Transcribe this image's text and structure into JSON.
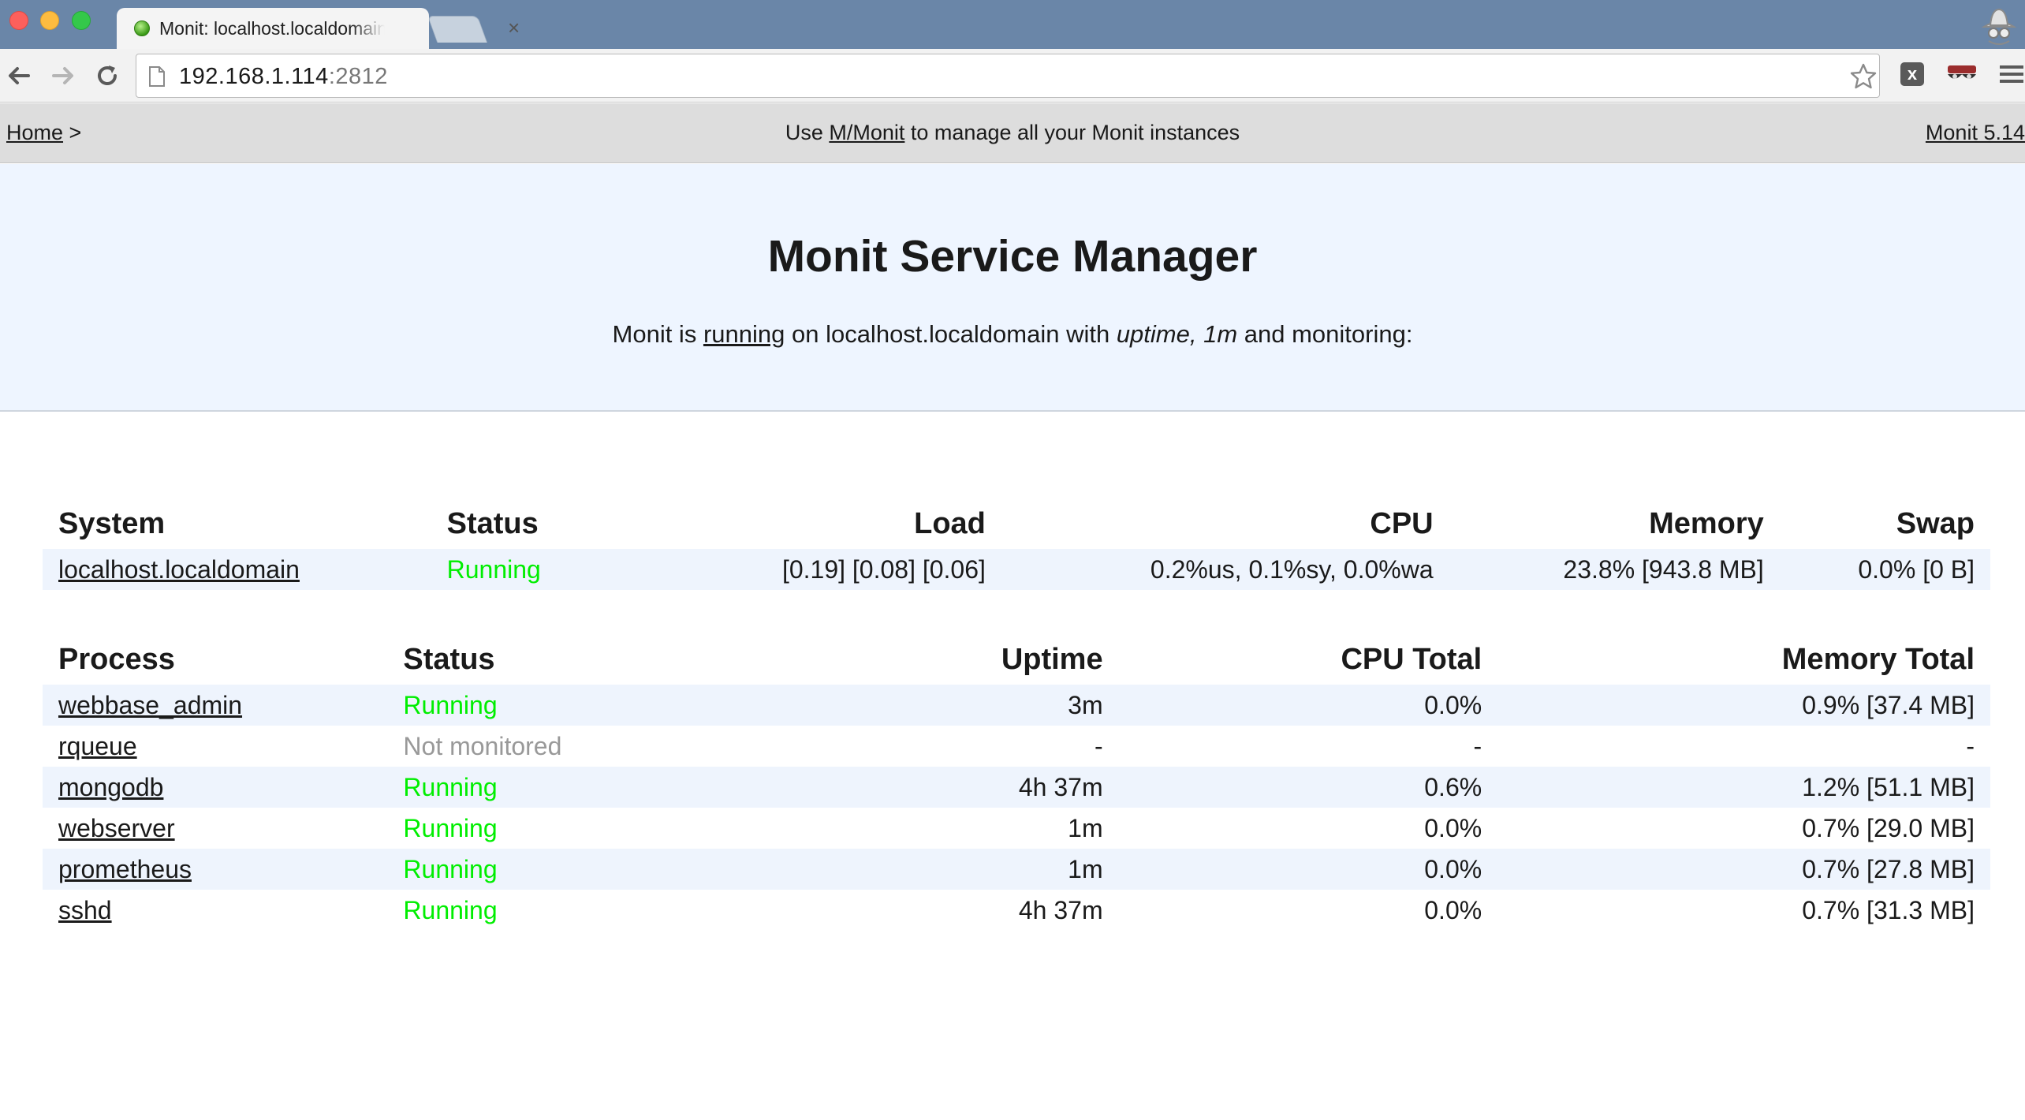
{
  "browser": {
    "tab_title": "Monit: localhost.localdomain",
    "tab_close": "×",
    "url_host": "192.168.1.114",
    "url_port": ":2812"
  },
  "nav": {
    "home_label": "Home",
    "crumb_sep": " >",
    "promo_prefix": "Use ",
    "promo_link": "M/Monit",
    "promo_suffix": " to manage all your Monit instances",
    "version_label": "Monit 5.14"
  },
  "header": {
    "title": "Monit Service Manager",
    "status_prefix": "Monit is ",
    "status_link": "running",
    "status_middle": " on localhost.localdomain with ",
    "uptime": "uptime, 1m",
    "status_suffix": "  and monitoring:"
  },
  "system_table": {
    "headers": {
      "system": "System",
      "status": "Status",
      "load": "Load",
      "cpu": "CPU",
      "memory": "Memory",
      "swap": "Swap"
    },
    "row": {
      "name": "localhost.localdomain",
      "status": "Running",
      "load": "[0.19] [0.08] [0.06]",
      "cpu": "0.2%us, 0.1%sy, 0.0%wa",
      "memory": "23.8% [943.8 MB]",
      "swap": "0.0% [0 B]"
    }
  },
  "process_table": {
    "headers": {
      "process": "Process",
      "status": "Status",
      "uptime": "Uptime",
      "cpu_total": "CPU Total",
      "memory_total": "Memory Total"
    },
    "rows": [
      {
        "name": "webbase_admin",
        "status": "Running",
        "uptime": "3m",
        "cpu": "0.0%",
        "memory": "0.9% [37.4 MB]"
      },
      {
        "name": "rqueue",
        "status": "Not monitored",
        "uptime": "-",
        "cpu": "-",
        "memory": "-"
      },
      {
        "name": "mongodb",
        "status": "Running",
        "uptime": "4h 37m",
        "cpu": "0.6%",
        "memory": "1.2% [51.1 MB]"
      },
      {
        "name": "webserver",
        "status": "Running",
        "uptime": "1m",
        "cpu": "0.0%",
        "memory": "0.7% [29.0 MB]"
      },
      {
        "name": "prometheus",
        "status": "Running",
        "uptime": "1m",
        "cpu": "0.0%",
        "memory": "0.7% [27.8 MB]"
      },
      {
        "name": "sshd",
        "status": "Running",
        "uptime": "4h 37m",
        "cpu": "0.0%",
        "memory": "0.7% [31.3 MB]"
      }
    ]
  },
  "colors": {
    "running": "#00ee00",
    "not_monitored": "#999999",
    "header_bg": "#eef5ff",
    "nav_bg": "#dddddd",
    "stripe_bg": "#eef4fd"
  },
  "icons": [
    "back-arrow-icon",
    "forward-arrow-icon",
    "reload-icon",
    "page-icon",
    "star-icon",
    "extension-x-icon",
    "incognito-mask-icon",
    "menu-icon",
    "spy-icon",
    "favicon-icon"
  ]
}
